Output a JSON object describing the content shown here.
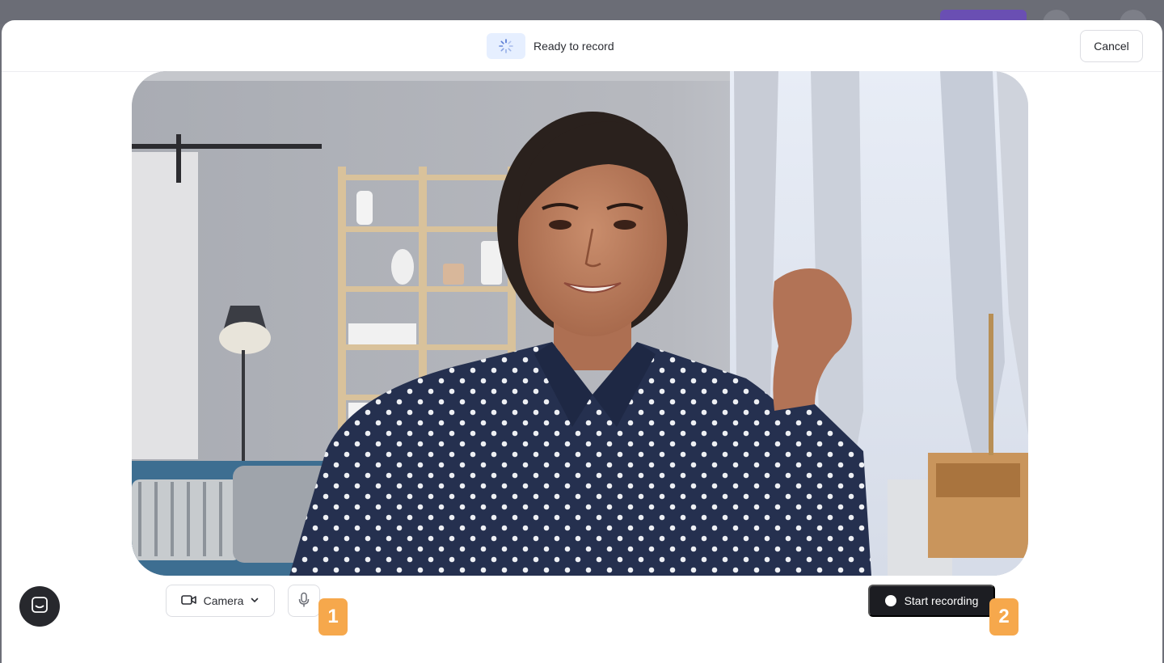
{
  "header": {
    "status_text": "Ready to record",
    "status_icon": "spinner-icon",
    "cancel_label": "Cancel"
  },
  "preview": {
    "content": "camera-feed"
  },
  "controls": {
    "camera_label": "Camera",
    "camera_icon": "video-camera-icon",
    "mic_icon": "microphone-icon",
    "record_label": "Start recording"
  },
  "annotations": {
    "marker_1": "1",
    "marker_2": "2",
    "color": "#f6a84c"
  },
  "colors": {
    "record_button_bg": "#1c1d22",
    "status_pill_bg": "#e6efff",
    "accent_purple": "#6a4fb3"
  }
}
